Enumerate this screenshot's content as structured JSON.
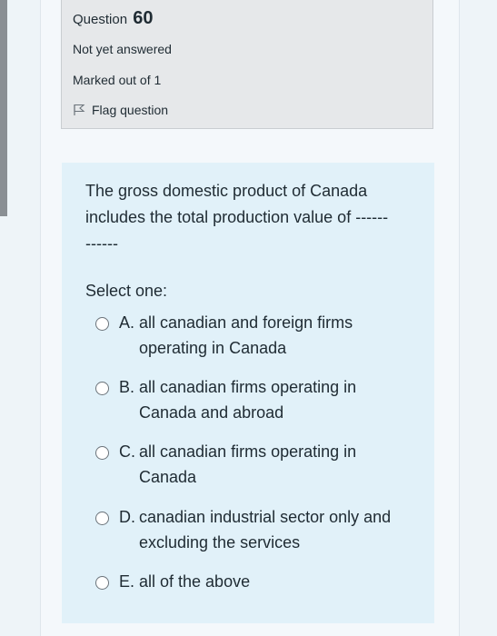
{
  "question": {
    "label": "Question",
    "number": "60",
    "status": "Not yet answered",
    "marks": "Marked out of 1",
    "flag_label": "Flag question"
  },
  "prompt": {
    "line1": "The gross domestic product of Canada",
    "line2": "includes the total production value of ------",
    "line3": "------",
    "select_label": "Select one:"
  },
  "options": [
    {
      "letter": "A.",
      "line1": "all canadian and foreign firms",
      "line2": "operating in Canada"
    },
    {
      "letter": "B.",
      "line1": "all canadian firms operating in",
      "line2": "Canada and abroad"
    },
    {
      "letter": "C.",
      "line1": "all canadian firms operating in",
      "line2": "Canada"
    },
    {
      "letter": "D.",
      "line1": "canadian industrial sector only and",
      "line2": "excluding the services"
    },
    {
      "letter": "E.",
      "line1": "all of the above",
      "line2": ""
    }
  ],
  "icons": {
    "flag": "flag-icon",
    "radio": "radio-icon"
  }
}
